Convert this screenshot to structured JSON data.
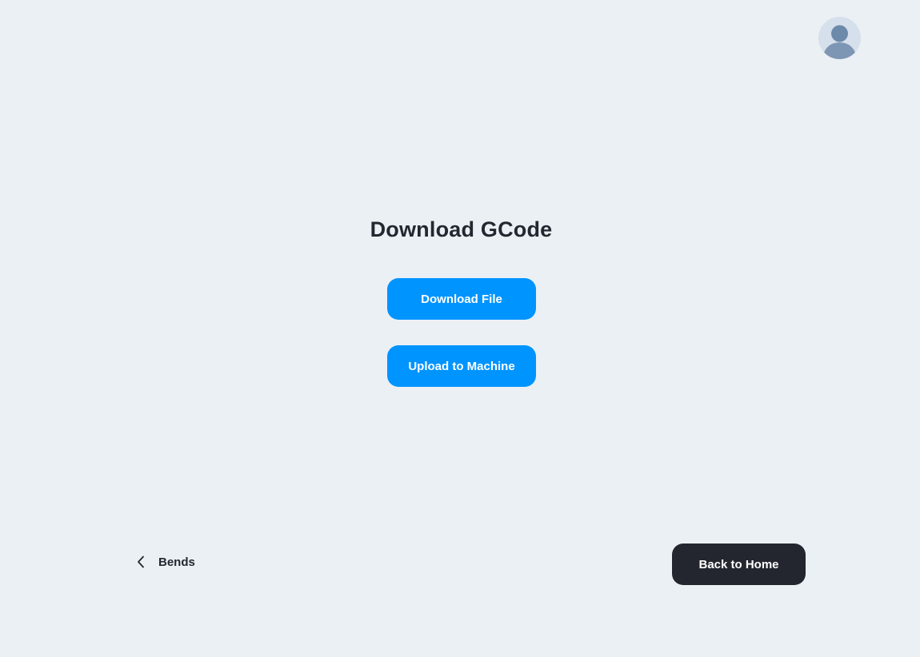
{
  "header": {
    "avatar_icon": "user-avatar-icon"
  },
  "main": {
    "title": "Download GCode",
    "download_button_label": "Download File",
    "upload_button_label": "Upload to Machine"
  },
  "footer": {
    "back_link_label": "Bends",
    "back_icon": "chevron-left-icon",
    "home_button_label": "Back to Home"
  },
  "colors": {
    "background": "#ebf0f5",
    "primary": "#0094ff",
    "dark": "#23262e",
    "text": "#23272f"
  }
}
